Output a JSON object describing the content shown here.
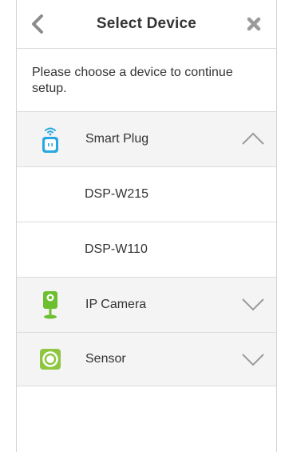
{
  "header": {
    "title": "Select Device",
    "back_icon": "chevron-left-icon",
    "close_icon": "close-x-icon"
  },
  "intro": {
    "text": "Please choose a device to continue setup."
  },
  "categories": [
    {
      "label": "Smart Plug",
      "icon": "smart-plug-icon",
      "expanded": true,
      "devices": [
        {
          "label": "DSP-W215"
        },
        {
          "label": "DSP-W110"
        }
      ]
    },
    {
      "label": "IP Camera",
      "icon": "ip-camera-icon",
      "expanded": false
    },
    {
      "label": "Sensor",
      "icon": "sensor-icon",
      "expanded": false
    }
  ],
  "colors": {
    "plug_blue": "#29a8e0",
    "camera_green": "#6cbf2f",
    "sensor_green": "#8ec63f",
    "chevron": "#9a9a9a"
  }
}
